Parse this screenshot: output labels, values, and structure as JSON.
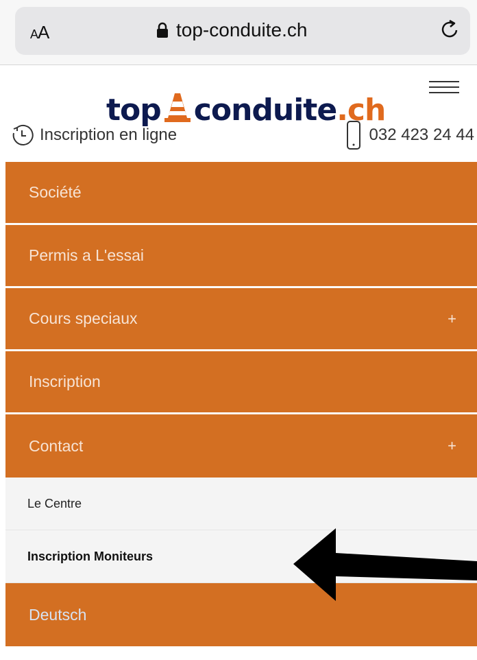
{
  "browser": {
    "aa_small": "A",
    "aa_large": "A",
    "url": "top-conduite.ch"
  },
  "header": {
    "logo_part1": "top",
    "logo_part2": "conduite",
    "logo_tld": ".ch",
    "inscription_link": "Inscription en ligne",
    "phone": "032 423 24 44"
  },
  "menu": {
    "items": [
      {
        "label": "Société",
        "has_plus": false
      },
      {
        "label": "Permis a L'essai",
        "has_plus": false
      },
      {
        "label": "Cours speciaux",
        "has_plus": true
      },
      {
        "label": "Inscription",
        "has_plus": false
      },
      {
        "label": "Contact",
        "has_plus": true
      }
    ],
    "plus_symbol": "+",
    "submenu": [
      {
        "label": "Le Centre"
      },
      {
        "label": "Inscription Moniteurs"
      }
    ],
    "deutsch": "Deutsch"
  },
  "colors": {
    "menu_bg": "#d36f22",
    "logo_navy": "#0d1a4f",
    "logo_orange": "#e06a1e"
  },
  "icons": [
    "lock-icon",
    "reload-icon",
    "menu-icon",
    "clock-icon",
    "phone-icon",
    "traffic-cone-icon",
    "arrow-icon"
  ]
}
